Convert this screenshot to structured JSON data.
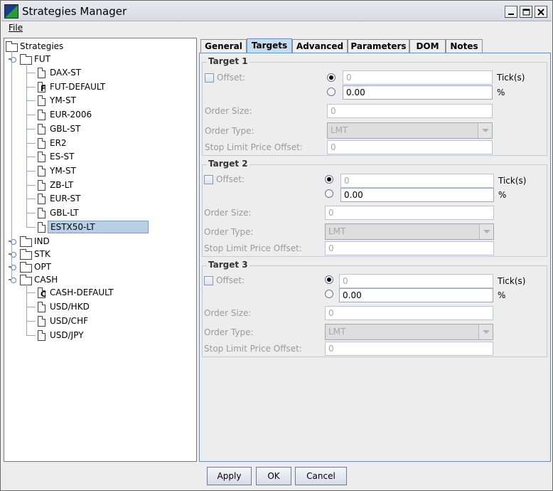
{
  "window": {
    "title": "Strategies Manager"
  },
  "menu": {
    "file": "File"
  },
  "tree": {
    "root": "Strategies",
    "fut": {
      "label": "FUT",
      "items": [
        "DAX-ST",
        "FUT-DEFAULT",
        "YM-ST",
        "EUR-2006",
        "GBL-ST",
        "ER2",
        "ES-ST",
        "YM-ST",
        "ZB-LT",
        "EUR-ST",
        "GBL-LT",
        "ESTX50-LT"
      ],
      "default_badge": "F",
      "selected": "ESTX50-LT"
    },
    "ind": "IND",
    "stk": "STK",
    "opt": "OPT",
    "cash": {
      "label": "CASH",
      "items": [
        "CASH-DEFAULT",
        "USD/HKD",
        "USD/CHF",
        "USD/JPY"
      ],
      "default_badge": "C"
    }
  },
  "tabs": [
    "General",
    "Targets",
    "Advanced",
    "Parameters",
    "DOM",
    "Notes"
  ],
  "active_tab": "Targets",
  "targets": [
    {
      "title": "Target 1",
      "offset_label": "Offset:",
      "ticks_value": "0",
      "ticks_unit": "Tick(s)",
      "percent_value": "0.00",
      "percent_unit": "%",
      "order_size_label": "Order Size:",
      "order_size": "0",
      "order_type_label": "Order Type:",
      "order_type": "LMT",
      "stop_label": "Stop Limit Price Offset:",
      "stop_value": "0"
    },
    {
      "title": "Target 2",
      "offset_label": "Offset:",
      "ticks_value": "0",
      "ticks_unit": "Tick(s)",
      "percent_value": "0.00",
      "percent_unit": "%",
      "order_size_label": "Order Size:",
      "order_size": "0",
      "order_type_label": "Order Type:",
      "order_type": "LMT",
      "stop_label": "Stop Limit Price Offset:",
      "stop_value": "0"
    },
    {
      "title": "Target 3",
      "offset_label": "Offset:",
      "ticks_value": "0",
      "ticks_unit": "Tick(s)",
      "percent_value": "0.00",
      "percent_unit": "%",
      "order_size_label": "Order Size:",
      "order_size": "0",
      "order_type_label": "Order Type:",
      "order_type": "LMT",
      "stop_label": "Stop Limit Price Offset:",
      "stop_value": "0"
    }
  ],
  "buttons": {
    "apply": "Apply",
    "ok": "OK",
    "cancel": "Cancel"
  }
}
